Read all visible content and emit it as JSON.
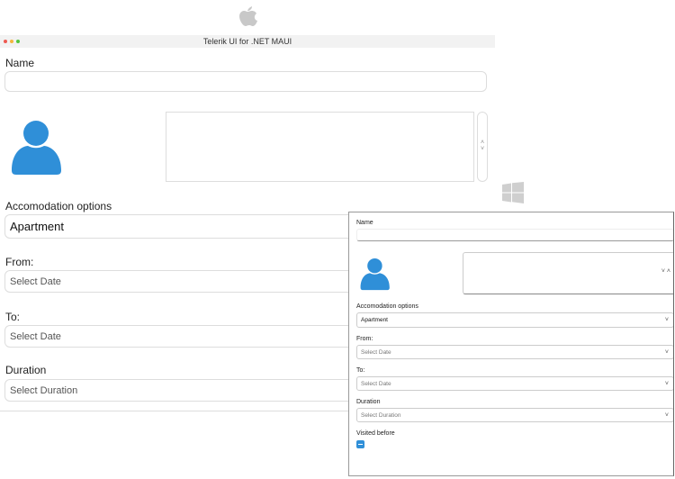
{
  "mac": {
    "title": "Telerik UI for .NET MAUI",
    "name_label": "Name",
    "name_value": "",
    "accommodation_label": "Accomodation options",
    "accommodation_value": "Apartment",
    "from_label": "From:",
    "from_placeholder": "Select Date",
    "to_label": "To:",
    "to_placeholder": "Select Date",
    "duration_label": "Duration",
    "duration_placeholder": "Select Duration"
  },
  "windows": {
    "name_label": "Name",
    "name_value": "",
    "accommodation_label": "Accomodation options",
    "accommodation_value": "Apartment",
    "from_label": "From:",
    "from_placeholder": "Select Date",
    "to_label": "To:",
    "to_placeholder": "Select Date",
    "duration_label": "Duration",
    "duration_placeholder": "Select Duration",
    "visited_label": "Visited before",
    "visited_state": "indeterminate"
  },
  "colors": {
    "accent": "#2f8fd8"
  }
}
